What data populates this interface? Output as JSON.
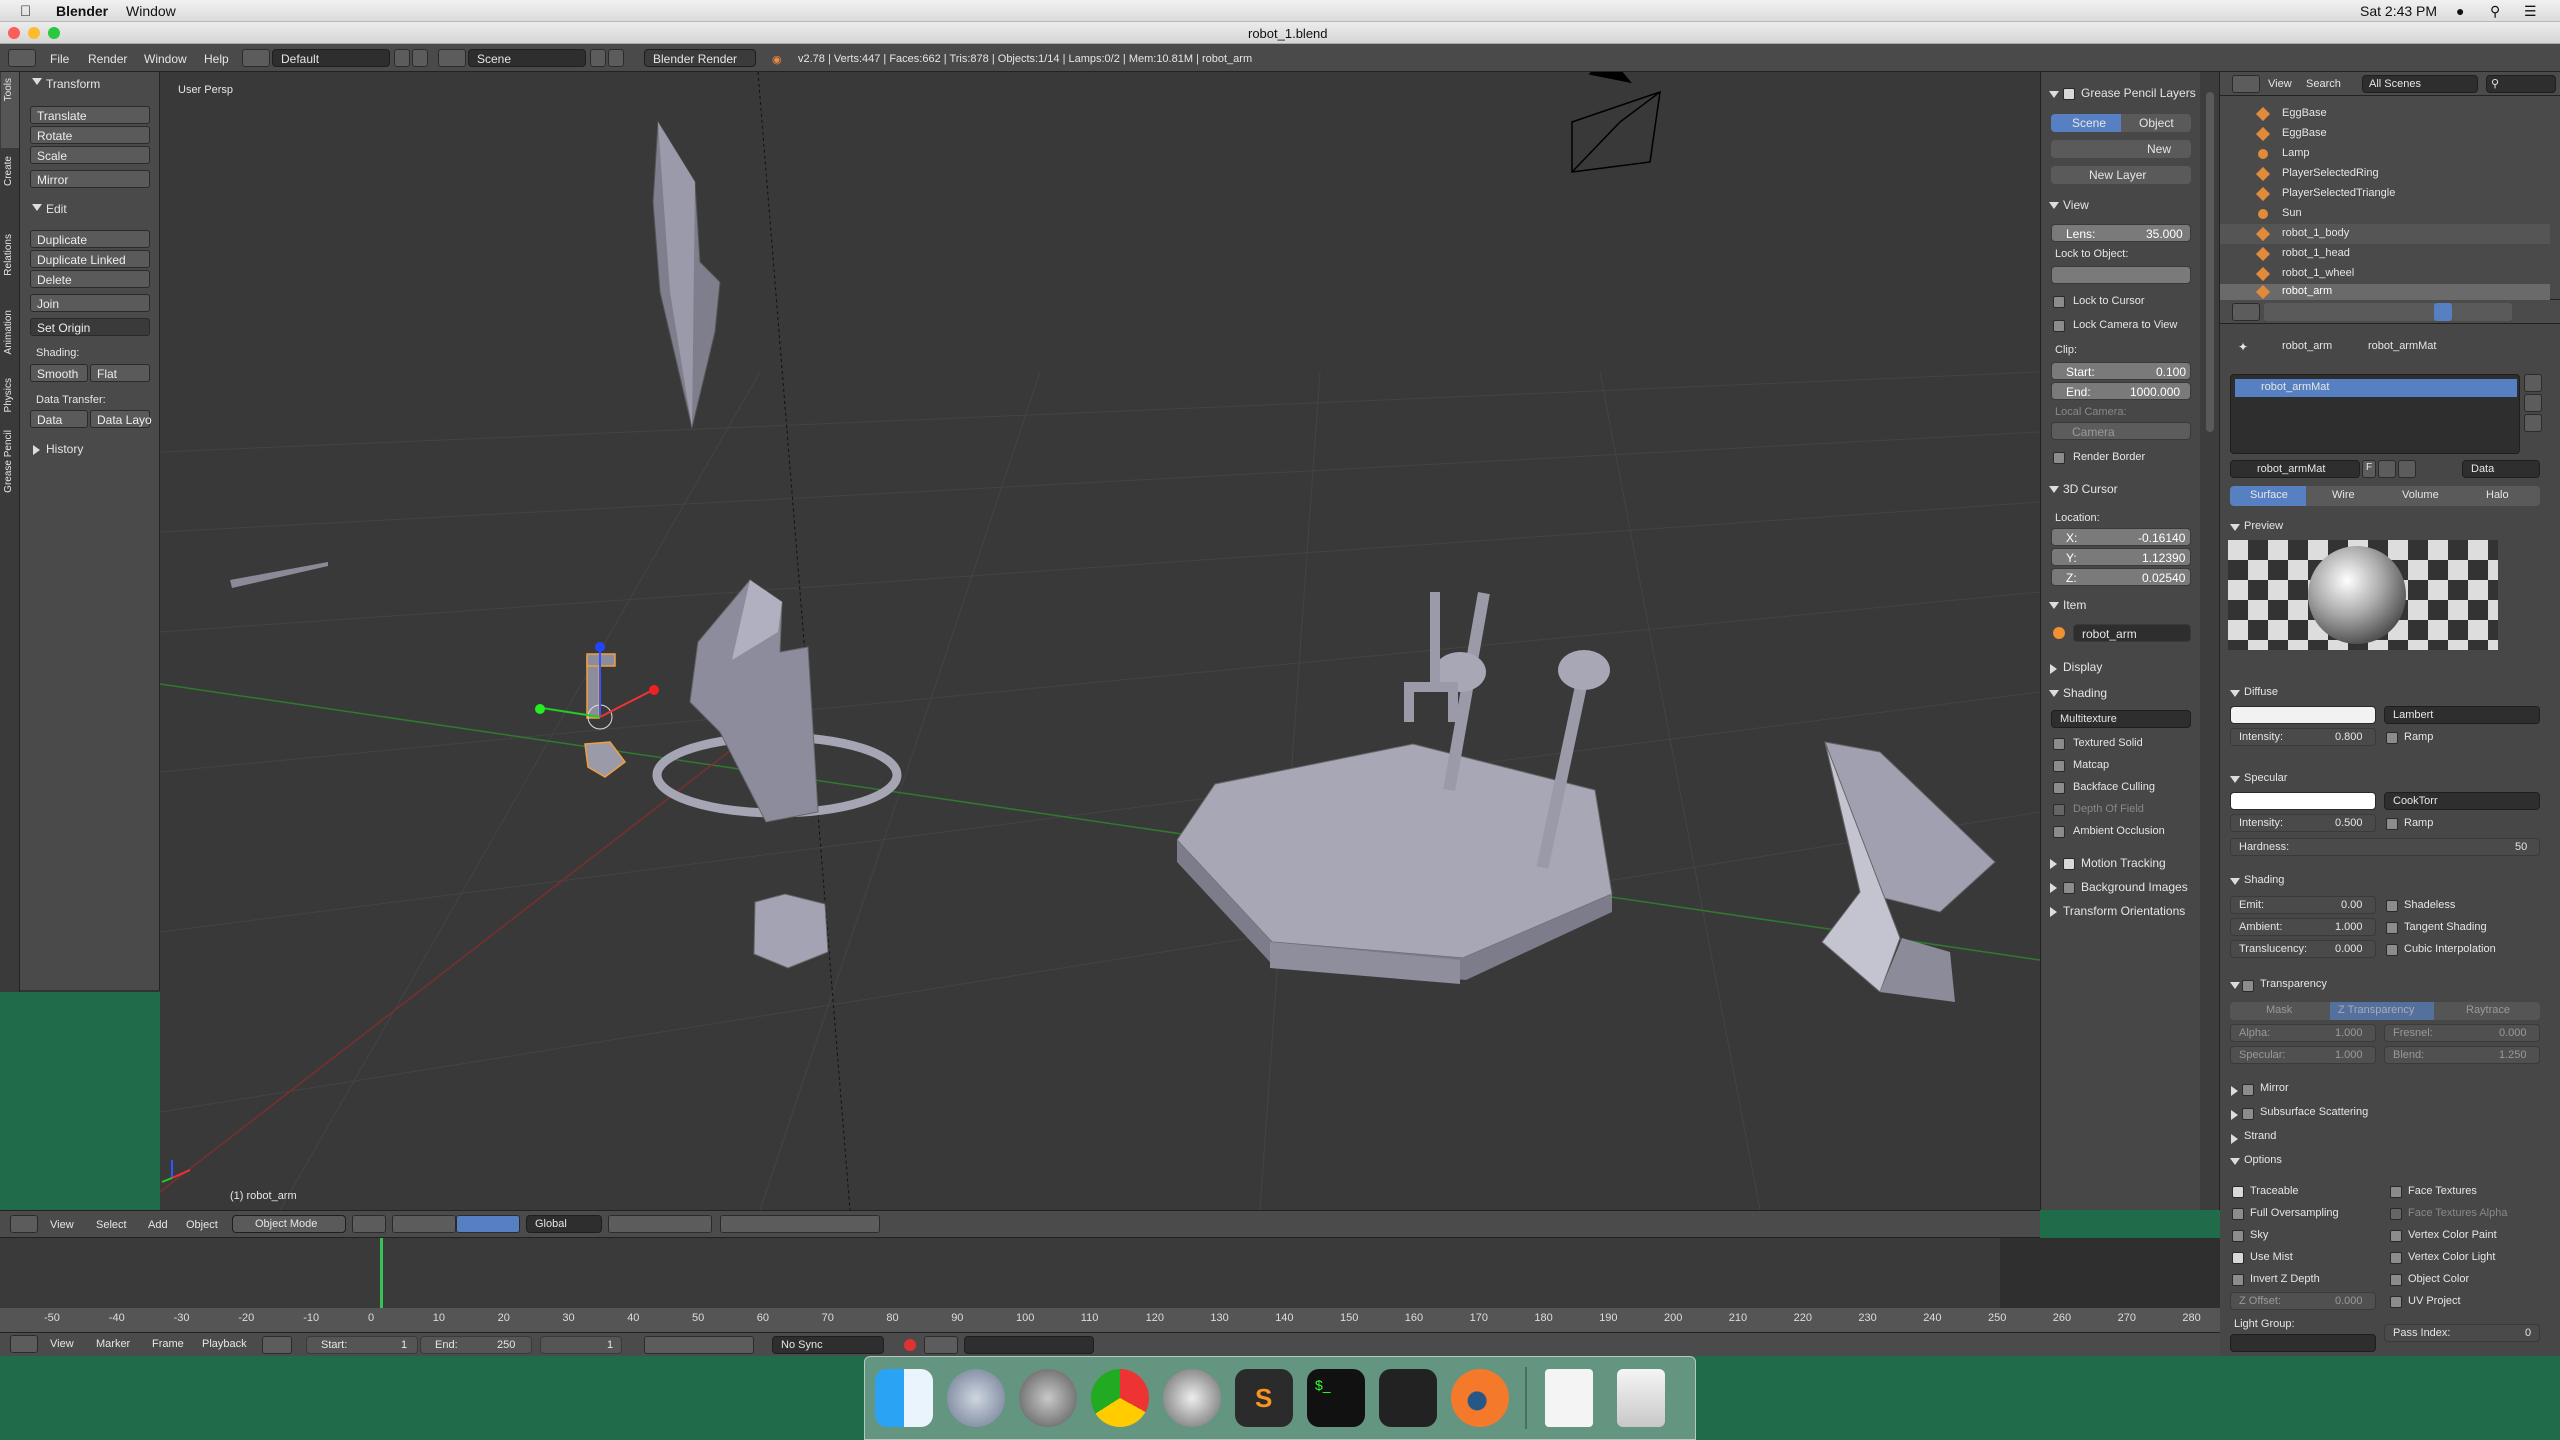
{
  "menubar": {
    "app": "Blender",
    "items": [
      "Window"
    ],
    "clock": "Sat 2:43 PM"
  },
  "window": {
    "title": "robot_1.blend"
  },
  "header": {
    "menus": [
      "File",
      "Render",
      "Window",
      "Help"
    ],
    "layout": "Default",
    "scene": "Scene",
    "engine": "Blender Render",
    "stats": "v2.78 | Verts:447 | Faces:662 | Tris:878 | Objects:1/14 | Lamps:0/2 | Mem:10.81M | robot_arm"
  },
  "tool_tabs": [
    "Tools",
    "Create",
    "Relations",
    "Animation",
    "Physics",
    "Grease Pencil"
  ],
  "tool_shelf": {
    "transform_header": "Transform",
    "transform_buttons": [
      "Translate",
      "Rotate",
      "Scale",
      "Mirror"
    ],
    "edit_header": "Edit",
    "edit_buttons": [
      "Duplicate",
      "Duplicate Linked",
      "Delete"
    ],
    "join": "Join",
    "set_origin": "Set Origin",
    "shading_label": "Shading:",
    "smooth": "Smooth",
    "flat": "Flat",
    "data_transfer_label": "Data Transfer:",
    "data": "Data",
    "data_layo": "Data Layo",
    "history": "History"
  },
  "viewport": {
    "label": "User Persp",
    "selected": "(1) robot_arm"
  },
  "n_panel": {
    "gp_header": "Grease Pencil Layers",
    "scene_tab": "Scene",
    "object_tab": "Object",
    "new": "New",
    "new_layer": "New Layer",
    "view_header": "View",
    "lens_label": "Lens:",
    "lens_value": "35.000",
    "lock_to_object": "Lock to Object:",
    "lock_to_cursor": "Lock to Cursor",
    "lock_camera_to_view": "Lock Camera to View",
    "clip_label": "Clip:",
    "start_label": "Start:",
    "start_value": "0.100",
    "end_label": "End:",
    "end_value": "1000.000",
    "local_camera": "Local Camera:",
    "camera": "Camera",
    "render_border": "Render Border",
    "cursor_header": "3D Cursor",
    "location_label": "Location:",
    "x_label": "X:",
    "x_value": "-0.16140",
    "y_label": "Y:",
    "y_value": "1.12390",
    "z_label": "Z:",
    "z_value": "0.02540",
    "item_header": "Item",
    "item_name": "robot_arm",
    "display_header": "Display",
    "shading_header": "Shading",
    "shading_mode": "Multitexture",
    "textured_solid": "Textured Solid",
    "matcap": "Matcap",
    "backface_culling": "Backface Culling",
    "depth_of_field": "Depth Of Field",
    "ambient_occlusion": "Ambient Occlusion",
    "motion_tracking": "Motion Tracking",
    "background_images": "Background Images",
    "transform_orientations": "Transform Orientations"
  },
  "outliner": {
    "view": "View",
    "search": "Search",
    "all_scenes": "All Scenes",
    "items": [
      "EggBase",
      "EggBase",
      "Lamp",
      "PlayerSelectedRing",
      "PlayerSelectedTriangle",
      "Sun",
      "robot_1_body",
      "robot_1_head",
      "robot_1_wheel",
      "robot_arm"
    ]
  },
  "properties": {
    "breadcrumb_object": "robot_arm",
    "breadcrumb_material": "robot_armMat",
    "material_slot": "robot_armMat",
    "material_name": "robot_armMat",
    "f_label": "F",
    "data_label": "Data",
    "tabs": [
      "Surface",
      "Wire",
      "Volume",
      "Halo"
    ],
    "preview": "Preview",
    "diffuse": "Diffuse",
    "diffuse_shader": "Lambert",
    "intensity_label": "Intensity:",
    "diffuse_intensity": "0.800",
    "ramp": "Ramp",
    "specular": "Specular",
    "specular_shader": "CookTorr",
    "specular_intensity": "0.500",
    "hardness_label": "Hardness:",
    "hardness_value": "50",
    "shading": "Shading",
    "emit_label": "Emit:",
    "emit_value": "0.00",
    "shadeless": "Shadeless",
    "ambient_label": "Ambient:",
    "ambient_value": "1.000",
    "tangent_shading": "Tangent Shading",
    "translucency_label": "Translucency:",
    "translucency_value": "0.000",
    "cubic_interpolation": "Cubic Interpolation",
    "transparency": "Transparency",
    "transp_modes": [
      "Mask",
      "Z Transparency",
      "Raytrace"
    ],
    "alpha_label": "Alpha:",
    "alpha_value": "1.000",
    "fresnel_label": "Fresnel:",
    "fresnel_value": "0.000",
    "specular_label": "Specular:",
    "specular_value": "1.000",
    "blend_label": "Blend:",
    "blend_value": "1.250",
    "mirror": "Mirror",
    "sss": "Subsurface Scattering",
    "strand": "Strand",
    "options": "Options",
    "traceable": "Traceable",
    "face_textures": "Face Textures",
    "full_oversampling": "Full Oversampling",
    "face_textures_alpha": "Face Textures Alpha",
    "sky": "Sky",
    "vertex_color_paint": "Vertex Color Paint",
    "use_mist": "Use Mist",
    "vertex_color_light": "Vertex Color Light",
    "invert_z_depth": "Invert Z Depth",
    "object_color": "Object Color",
    "z_offset_label": "Z Offset:",
    "z_offset_value": "0.000",
    "uv_project": "UV Project",
    "light_group": "Light Group:",
    "pass_index_label": "Pass Index:",
    "pass_index_value": "0"
  },
  "vp_header": {
    "menus": [
      "View",
      "Select",
      "Add",
      "Object"
    ],
    "mode": "Object Mode",
    "orientation": "Global"
  },
  "timeline": {
    "ticks": [
      "-50",
      "-40",
      "-30",
      "-20",
      "-10",
      "0",
      "10",
      "20",
      "30",
      "40",
      "50",
      "60",
      "70",
      "80",
      "90",
      "100",
      "110",
      "120",
      "130",
      "140",
      "150",
      "160",
      "170",
      "180",
      "190",
      "200",
      "210",
      "220",
      "230",
      "240",
      "250",
      "260",
      "270",
      "280"
    ],
    "menus": [
      "View",
      "Marker",
      "Frame",
      "Playback"
    ],
    "start_label": "Start:",
    "start_value": "1",
    "end_label": "End:",
    "end_value": "250",
    "current": "1",
    "sync": "No Sync"
  },
  "dock": {
    "apps": [
      "Finder",
      "Launchpad",
      "System Preferences",
      "Chrome",
      "Archive",
      "Sublime Text",
      "Terminal",
      "Unity",
      "Blender",
      "Preview",
      "Trash"
    ]
  }
}
